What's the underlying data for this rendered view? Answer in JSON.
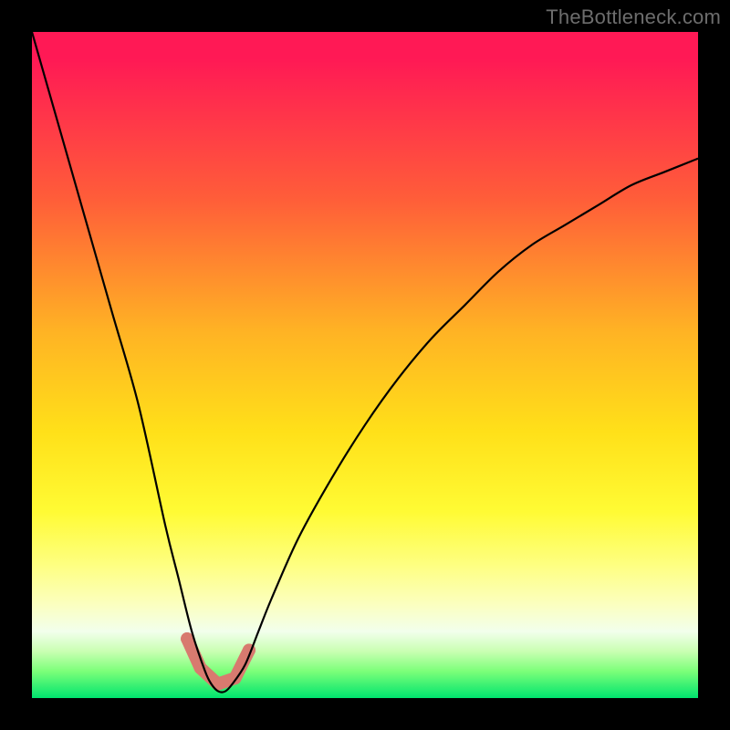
{
  "watermark": "TheBottleneck.com",
  "chart_data": {
    "type": "line",
    "title": "",
    "xlabel": "",
    "ylabel": "",
    "xlim": [
      0,
      100
    ],
    "ylim": [
      0,
      100
    ],
    "grid": false,
    "legend": false,
    "note": "Values estimated from the curve in a 0-100 normalized plot area (origin bottom-left). Curve shows deviation/bottleneck percentage with minimum near x≈28.",
    "background_gradient": {
      "top_color": "#ff1955",
      "bottom_color": "#00e46e"
    },
    "series": [
      {
        "name": "bottleneck-curve",
        "color": "#000000",
        "x": [
          0,
          4,
          8,
          12,
          16,
          20,
          22,
          24,
          26,
          27,
          28,
          29,
          30,
          32,
          34,
          36,
          40,
          45,
          50,
          55,
          60,
          65,
          70,
          75,
          80,
          85,
          90,
          95,
          100
        ],
        "values": [
          100,
          86,
          72,
          58,
          44,
          26,
          18,
          10,
          4,
          2,
          1,
          1,
          2,
          5,
          10,
          15,
          24,
          33,
          41,
          48,
          54,
          59,
          64,
          68,
          71,
          74,
          77,
          79,
          81
        ]
      }
    ],
    "highlight_markers": {
      "color": "#d87a6f",
      "description": "Rounded segments highlighting the curve near its minimum",
      "points_x": [
        23.3,
        25.3,
        27.9,
        30.5,
        32.6
      ],
      "points_y": [
        8.9,
        4.5,
        2.1,
        3.0,
        7.2
      ]
    }
  }
}
